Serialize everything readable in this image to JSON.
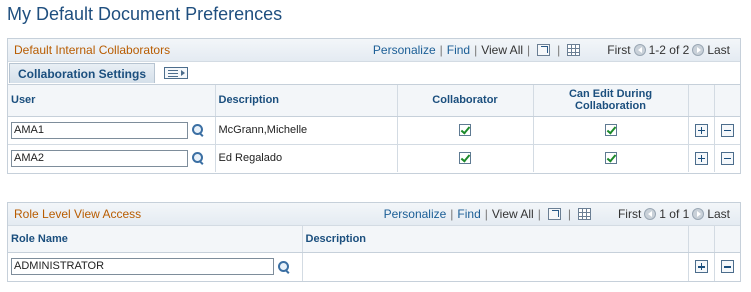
{
  "page": {
    "title": "My Default Document Preferences"
  },
  "collaborators": {
    "title": "Default Internal Collaborators",
    "nav": {
      "personalize": "Personalize",
      "find": "Find",
      "view_all": "View All",
      "first": "First",
      "range": "1-2 of 2",
      "last": "Last"
    },
    "tab_label": "Collaboration Settings",
    "columns": {
      "user": "User",
      "description": "Description",
      "collaborator": "Collaborator",
      "can_edit": "Can Edit During Collaboration"
    },
    "rows": [
      {
        "user": "AMA1",
        "description": "McGrann,Michelle",
        "collaborator": true,
        "can_edit": true
      },
      {
        "user": "AMA2",
        "description": "Ed Regalado",
        "collaborator": true,
        "can_edit": true
      }
    ]
  },
  "role_access": {
    "title": "Role Level View Access",
    "nav": {
      "personalize": "Personalize",
      "find": "Find",
      "view_all": "View All",
      "first": "First",
      "range": "1 of 1",
      "last": "Last"
    },
    "columns": {
      "role_name": "Role Name",
      "description": "Description"
    },
    "rows": [
      {
        "role_name": "ADMINISTRATOR",
        "description": ""
      }
    ]
  },
  "icons": {
    "lookup": "magnifier-icon",
    "zoom": "zoom-icon",
    "download": "grid-icon",
    "add_row": "plus-icon",
    "delete_row": "minus-icon",
    "show_all_columns": "columns-icon"
  },
  "colors": {
    "title": "#1f4f7f",
    "section_title": "#b85c00",
    "link": "#1b5e96",
    "check": "#1c8a2a"
  }
}
